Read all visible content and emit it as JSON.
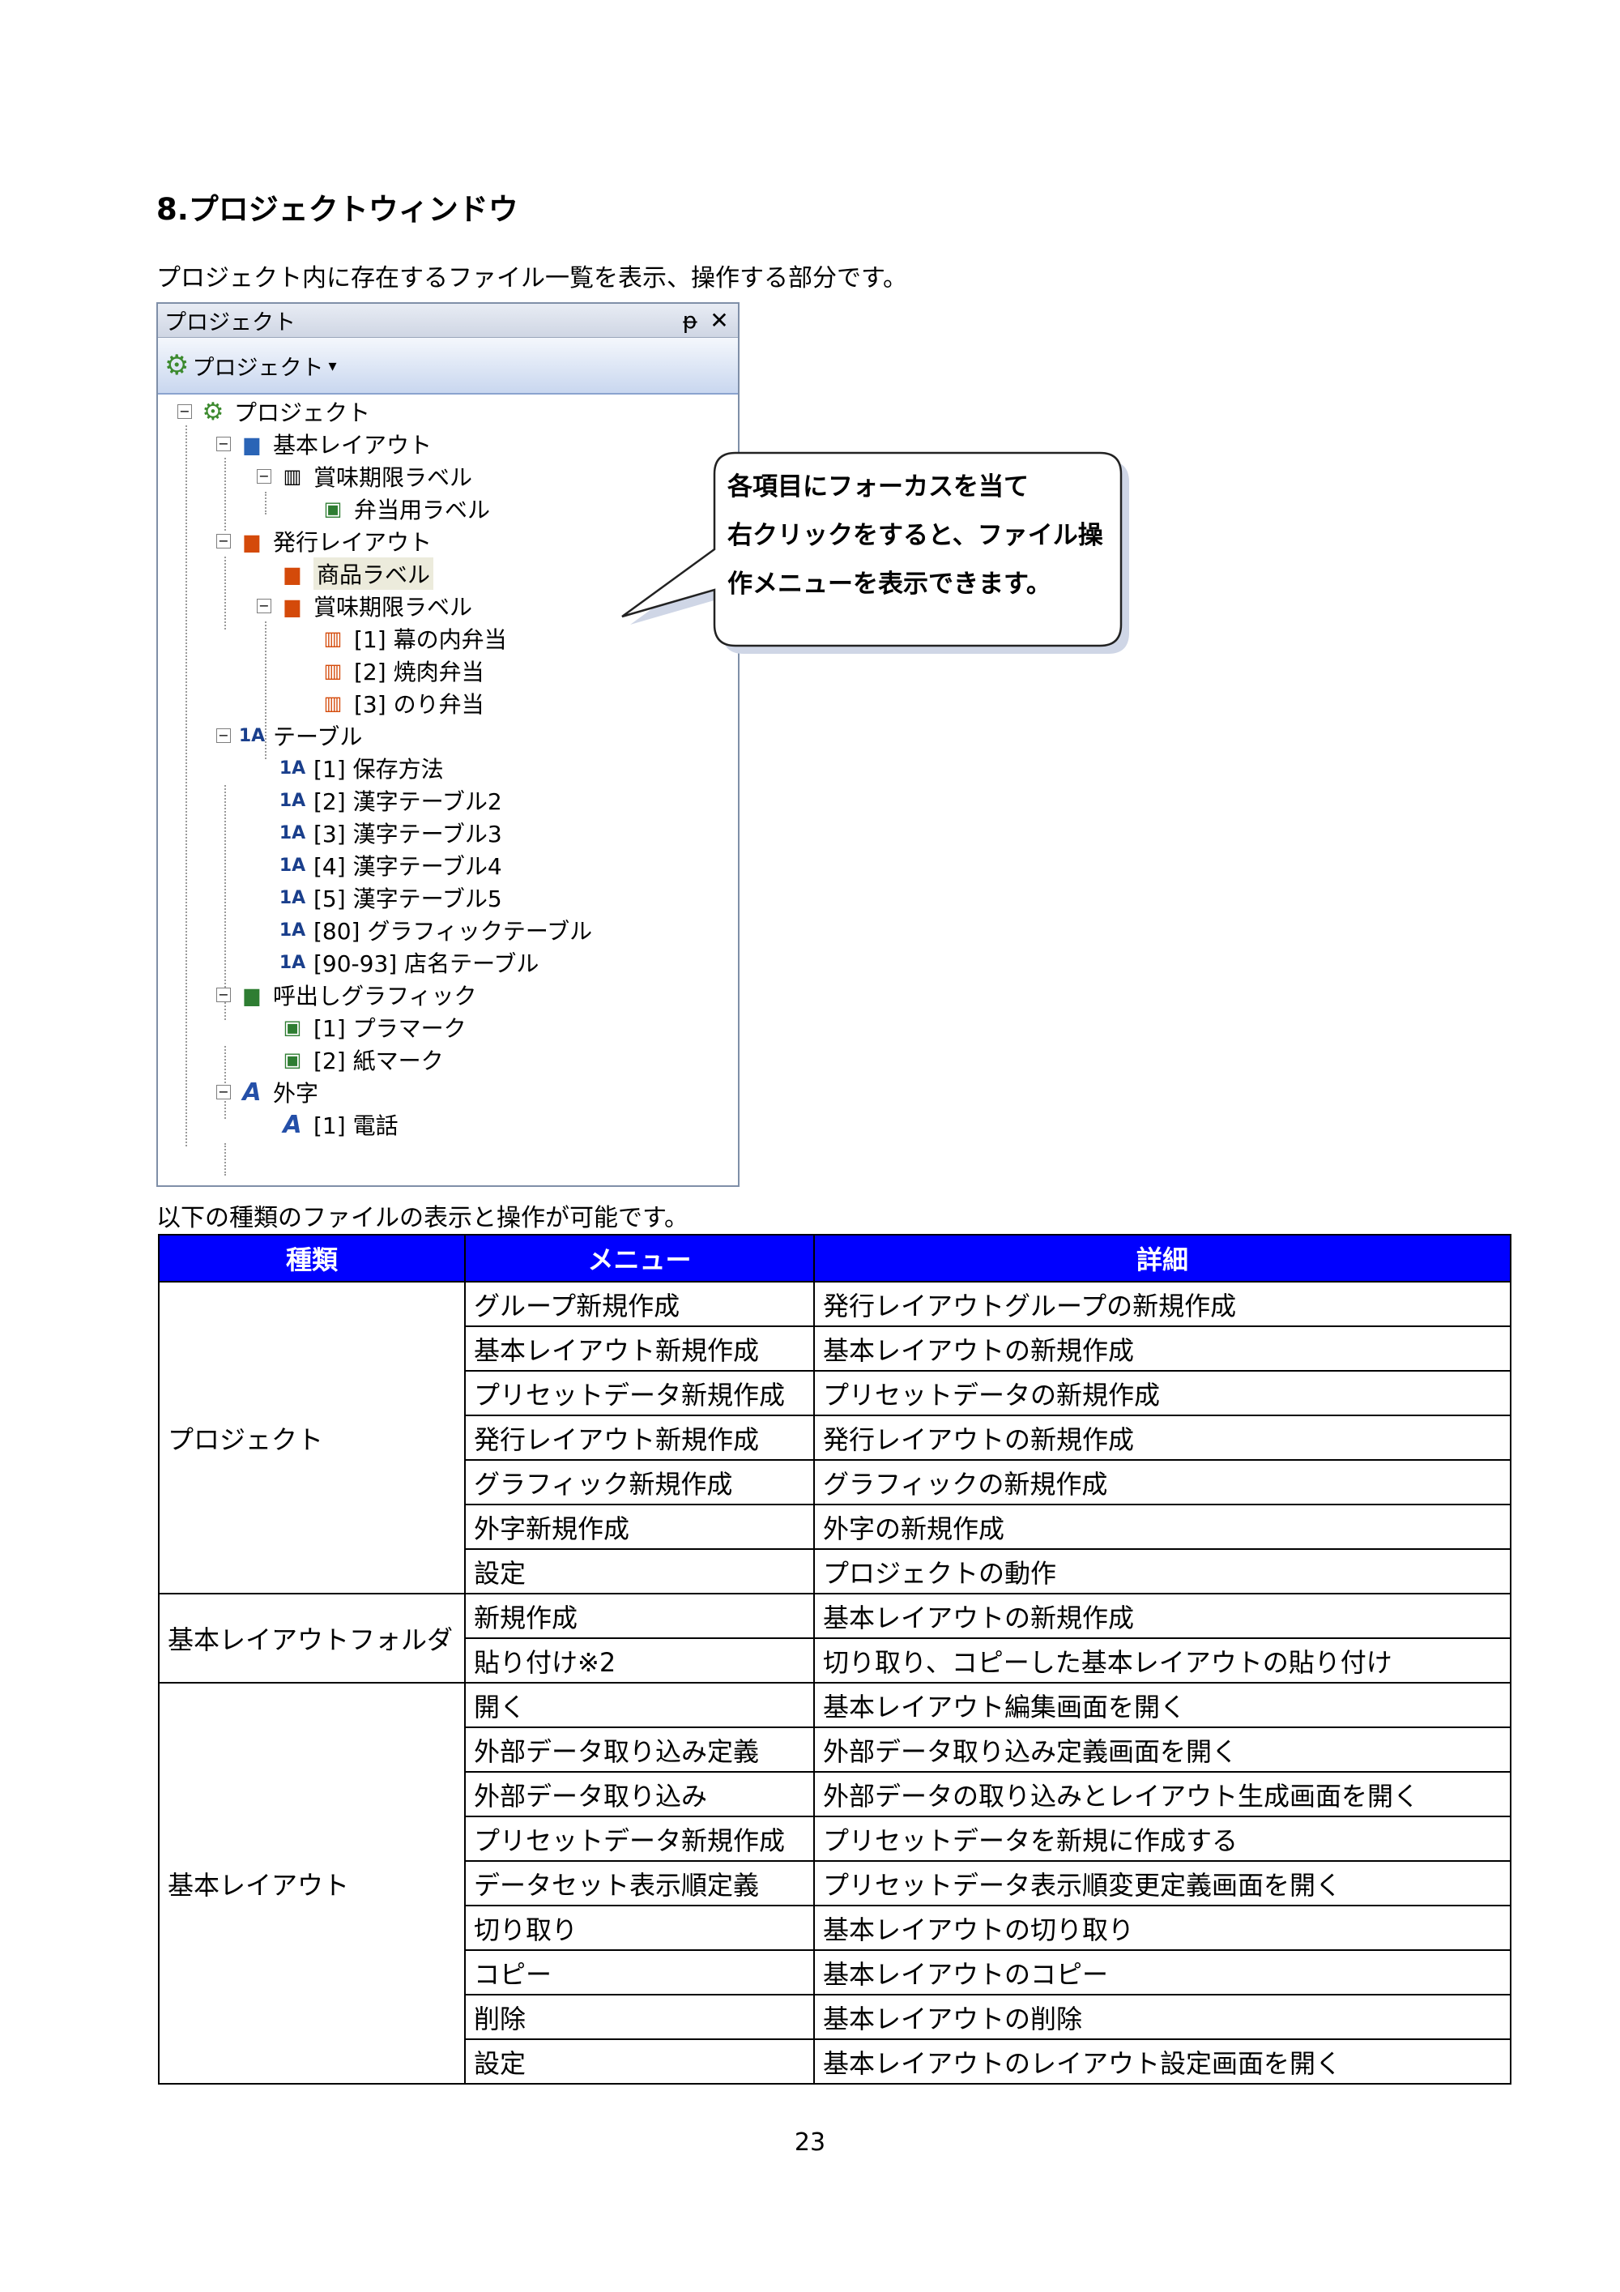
{
  "heading": "8.プロジェクトウィンドウ",
  "intro": "プロジェクト内に存在するファイル一覧を表示、操作する部分です。",
  "panel": {
    "title": "プロジェクト",
    "pin": "ᵽ",
    "close": "✕",
    "toolbar_label": "プロジェクト",
    "caret": "▾",
    "tree": {
      "root": "プロジェクト",
      "basic_layout": "基本レイアウト",
      "expiry_label": "賞味期限ラベル",
      "bento_label": "弁当用ラベル",
      "issue_layout": "発行レイアウト",
      "product_label": "商品ラベル",
      "expiry_label2": "賞味期限ラベル",
      "item1": "[1] 幕の内弁当",
      "item2": "[2] 焼肉弁当",
      "item3": "[3] のり弁当",
      "table": "テーブル",
      "t1": "[1] 保存方法",
      "t2": "[2] 漢字テーブル2",
      "t3": "[3] 漢字テーブル3",
      "t4": "[4] 漢字テーブル4",
      "t5": "[5] 漢字テーブル5",
      "t80": "[80] グラフィックテーブル",
      "t90": "[90-93] 店名テーブル",
      "callgfx": "呼出しグラフィック",
      "g1": "[1] プラマーク",
      "g2": "[2] 紙マーク",
      "gaiji": "外字",
      "gaiji1": "[1] 電話"
    }
  },
  "callout": {
    "line1": "各項目にフォーカスを当て",
    "line2": "右クリックをすると、ファイル操",
    "line3": "作メニューを表示できます。"
  },
  "subintro": "以下の種類のファイルの表示と操作が可能です。",
  "table": {
    "headers": [
      "種類",
      "メニュー",
      "詳細"
    ],
    "groups": [
      {
        "type": "プロジェクト",
        "rows": [
          [
            "グループ新規作成",
            "発行レイアウトグループの新規作成"
          ],
          [
            "基本レイアウト新規作成",
            "基本レイアウトの新規作成"
          ],
          [
            "プリセットデータ新規作成",
            "プリセットデータの新規作成"
          ],
          [
            "発行レイアウト新規作成",
            "発行レイアウトの新規作成"
          ],
          [
            "グラフィック新規作成",
            "グラフィックの新規作成"
          ],
          [
            "外字新規作成",
            "外字の新規作成"
          ],
          [
            "設定",
            "プロジェクトの動作"
          ]
        ]
      },
      {
        "type": "基本レイアウトフォルダ",
        "rows": [
          [
            "新規作成",
            "基本レイアウトの新規作成"
          ],
          [
            "貼り付け※2",
            "切り取り、コピーした基本レイアウトの貼り付け"
          ]
        ]
      },
      {
        "type": "基本レイアウト",
        "rows": [
          [
            "開く",
            "基本レイアウト編集画面を開く"
          ],
          [
            "外部データ取り込み定義",
            "外部データ取り込み定義画面を開く"
          ],
          [
            "外部データ取り込み",
            "外部データの取り込みとレイアウト生成画面を開く"
          ],
          [
            "プリセットデータ新規作成",
            "プリセットデータを新規に作成する"
          ],
          [
            "データセット表示順定義",
            "プリセットデータ表示順変更定義画面を開く"
          ],
          [
            "切り取り",
            "基本レイアウトの切り取り"
          ],
          [
            "コピー",
            "基本レイアウトのコピー"
          ],
          [
            "削除",
            "基本レイアウトの削除"
          ],
          [
            "設定",
            "基本レイアウトのレイアウト設定画面を開く"
          ]
        ]
      }
    ]
  },
  "page_number": "23"
}
